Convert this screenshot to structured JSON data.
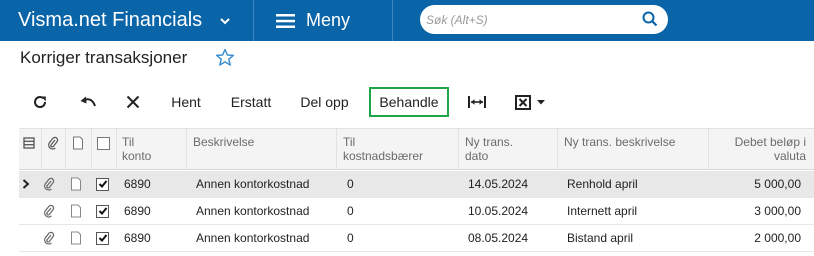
{
  "app": {
    "title": "Visma.net Financials",
    "menu_label": "Meny",
    "search_placeholder": "Søk (Alt+S)",
    "brand_color": "#0a64a8"
  },
  "page": {
    "title": "Korriger transaksjoner"
  },
  "toolbar": {
    "refresh_icon": "refresh-icon",
    "undo_icon": "undo-icon",
    "close_icon": "close-icon",
    "hent": "Hent",
    "erstatt": "Erstatt",
    "del_opp": "Del opp",
    "behandle": "Behandle",
    "fit_icon": "fit-width-icon",
    "excel_icon": "excel-export-icon",
    "highlight_color": "#1ea54a"
  },
  "table": {
    "headers": {
      "til_konto_1": "Til",
      "til_konto_2": "konto",
      "beskrivelse": "Beskrivelse",
      "til_kost_1": "Til",
      "til_kost_2": "kostnadsbærer",
      "ny_dato_1": "Ny trans.",
      "ny_dato_2": "dato",
      "ny_beskr": "Ny trans. beskrivelse",
      "debet_1": "Debet beløp i",
      "debet_2": "valuta"
    },
    "rows": [
      {
        "selected": true,
        "checked": true,
        "til_konto": "6890",
        "beskrivelse": "Annen kontorkostnad",
        "til_kostnadsbaerer": "0",
        "ny_dato": "14.05.2024",
        "ny_beskrivelse": "Renhold april",
        "debet": "5 000,00"
      },
      {
        "selected": false,
        "checked": true,
        "til_konto": "6890",
        "beskrivelse": "Annen kontorkostnad",
        "til_kostnadsbaerer": "0",
        "ny_dato": "10.05.2024",
        "ny_beskrivelse": "Internett april",
        "debet": "3 000,00"
      },
      {
        "selected": false,
        "checked": true,
        "til_konto": "6890",
        "beskrivelse": "Annen kontorkostnad",
        "til_kostnadsbaerer": "0",
        "ny_dato": "08.05.2024",
        "ny_beskrivelse": "Bistand april",
        "debet": "2 000,00"
      }
    ]
  }
}
